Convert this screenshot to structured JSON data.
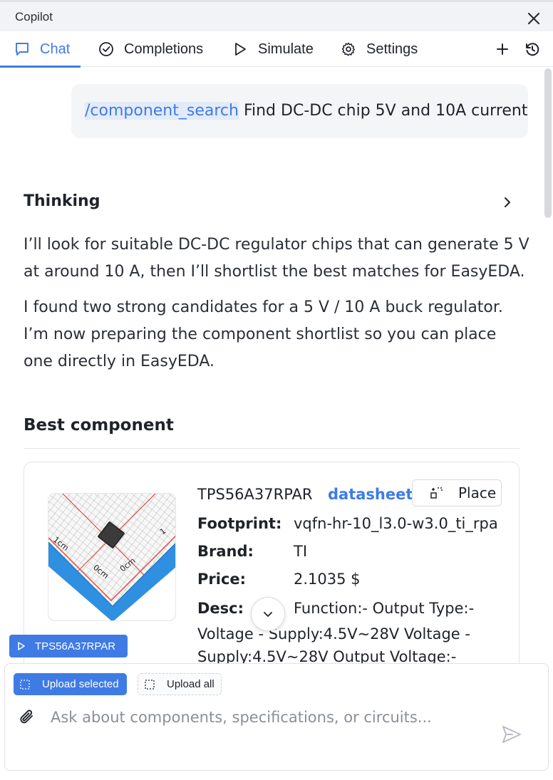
{
  "window": {
    "title": "Copilot"
  },
  "tabs": [
    {
      "label": "Chat",
      "icon": "chat-bubble-icon",
      "active": true
    },
    {
      "label": "Completions",
      "icon": "check-circle-icon"
    },
    {
      "label": "Simulate",
      "icon": "play-icon"
    },
    {
      "label": "Settings",
      "icon": "gear-icon"
    }
  ],
  "toolbar": {
    "new_icon": "plus-icon",
    "history_icon": "history-icon"
  },
  "user_message": {
    "command": "/component_search",
    "text": " Find DC-DC chip 5V and 10A current"
  },
  "thinking": {
    "label": "Thinking",
    "paragraphs": [
      "I’ll look for suitable DC-DC regulator chips that can generate 5 V at around 10 A, then I’ll shortlist the best matches for EasyEDA.",
      "I found two strong candidates for a 5 V / 10 A buck regulator. I’m now preparing the component shortlist so you can place one directly in EasyEDA."
    ]
  },
  "best_component": {
    "heading": "Best component",
    "name": "TPS56A37RPAR",
    "datasheet_label": "datasheet",
    "place_label": "Place",
    "fields": {
      "footprint_label": "Footprint:",
      "footprint": "vqfn-hr-10_l3.0-w3.0_ti_rpa",
      "brand_label": "Brand:",
      "brand": "TI",
      "price_label": "Price:",
      "price": "2.1035 $",
      "desc_label": "Desc:",
      "desc_first": "Function:- Output Type:-",
      "desc_rest": "Voltage - Supply:4.5V~28V Voltage - Supply:4.5V~28V Output Voltage:-"
    }
  },
  "component_chip": {
    "label": "TPS56A37RPAR"
  },
  "composer": {
    "upload_selected": "Upload selected",
    "upload_all": "Upload all",
    "placeholder": "Ask about components, specifications, or circuits...",
    "value": ""
  },
  "colors": {
    "accent": "#3f7be4",
    "chip_blue": "#2f8fe0",
    "grid_red": "#e0584f"
  }
}
